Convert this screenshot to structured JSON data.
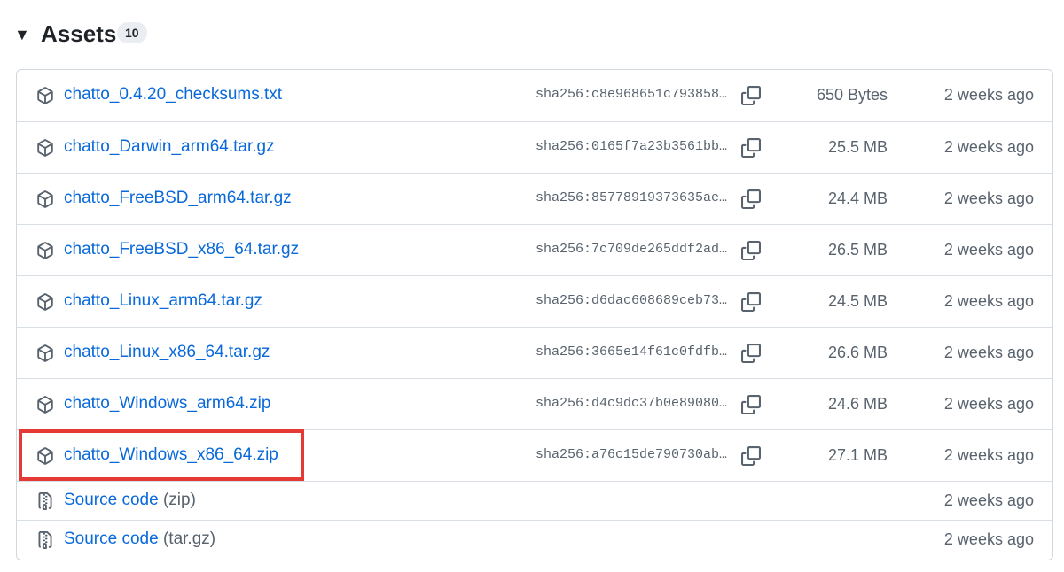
{
  "header": {
    "toggle_glyph": "▼",
    "title": "Assets",
    "count": "10"
  },
  "assets": [
    {
      "name": "chatto_0.4.20_checksums.txt",
      "sha": "sha256:c8e968651c793858c…",
      "size": "650 Bytes",
      "date": "2 weeks ago",
      "icon": "package-icon"
    },
    {
      "name": "chatto_Darwin_arm64.tar.gz",
      "sha": "sha256:0165f7a23b3561bbc…",
      "size": "25.5 MB",
      "date": "2 weeks ago",
      "icon": "package-icon"
    },
    {
      "name": "chatto_FreeBSD_arm64.tar.gz",
      "sha": "sha256:85778919373635ae5…",
      "size": "24.4 MB",
      "date": "2 weeks ago",
      "icon": "package-icon"
    },
    {
      "name": "chatto_FreeBSD_x86_64.tar.gz",
      "sha": "sha256:7c709de265ddf2ad4…",
      "size": "26.5 MB",
      "date": "2 weeks ago",
      "icon": "package-icon"
    },
    {
      "name": "chatto_Linux_arm64.tar.gz",
      "sha": "sha256:d6dac608689ceb732…",
      "size": "24.5 MB",
      "date": "2 weeks ago",
      "icon": "package-icon"
    },
    {
      "name": "chatto_Linux_x86_64.tar.gz",
      "sha": "sha256:3665e14f61c0fdfb1…",
      "size": "26.6 MB",
      "date": "2 weeks ago",
      "icon": "package-icon"
    },
    {
      "name": "chatto_Windows_arm64.zip",
      "sha": "sha256:d4c9dc37b0e89080a…",
      "size": "24.6 MB",
      "date": "2 weeks ago",
      "icon": "package-icon"
    },
    {
      "name": "chatto_Windows_x86_64.zip",
      "sha": "sha256:a76c15de790730abb…",
      "size": "27.1 MB",
      "date": "2 weeks ago",
      "icon": "package-icon"
    }
  ],
  "source": [
    {
      "label": "Source code",
      "format": "(zip)",
      "date": "2 weeks ago",
      "icon": "file-zip-icon"
    },
    {
      "label": "Source code",
      "format": "(tar.gz)",
      "date": "2 weeks ago",
      "icon": "file-zip-icon"
    }
  ],
  "colors": {
    "link": "#0969da",
    "muted": "#59636e",
    "border": "#d0d7de",
    "highlight": "#e53935"
  }
}
